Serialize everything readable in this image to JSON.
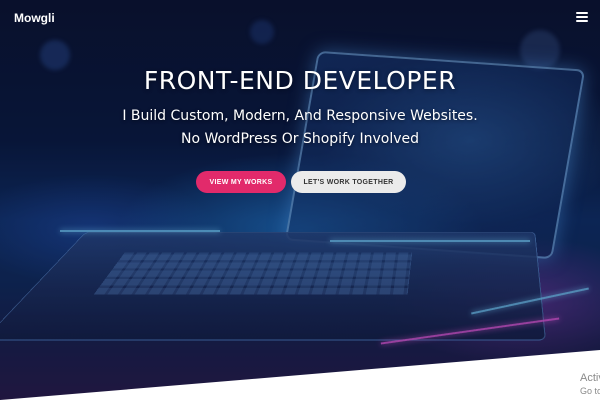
{
  "brand": {
    "name": "Mowgli"
  },
  "header": {
    "menu_icon": "hamburger-menu-icon"
  },
  "hero": {
    "title": "FRONT-END DEVELOPER",
    "subtitle_line1": "I Build Custom, Modern, And Responsive Websites.",
    "subtitle_line2": "No WordPress Or Shopify Involved",
    "primary_button": "VIEW MY WORKS",
    "secondary_button": "LET'S WORK TOGETHER"
  },
  "watermark": {
    "line1": "Activ",
    "line2": "Go to"
  },
  "colors": {
    "accent": "#e22a6b",
    "secondary_button_bg": "#ebebeb",
    "secondary_button_text": "#333333",
    "text": "#ffffff",
    "background": "#0a1940"
  }
}
